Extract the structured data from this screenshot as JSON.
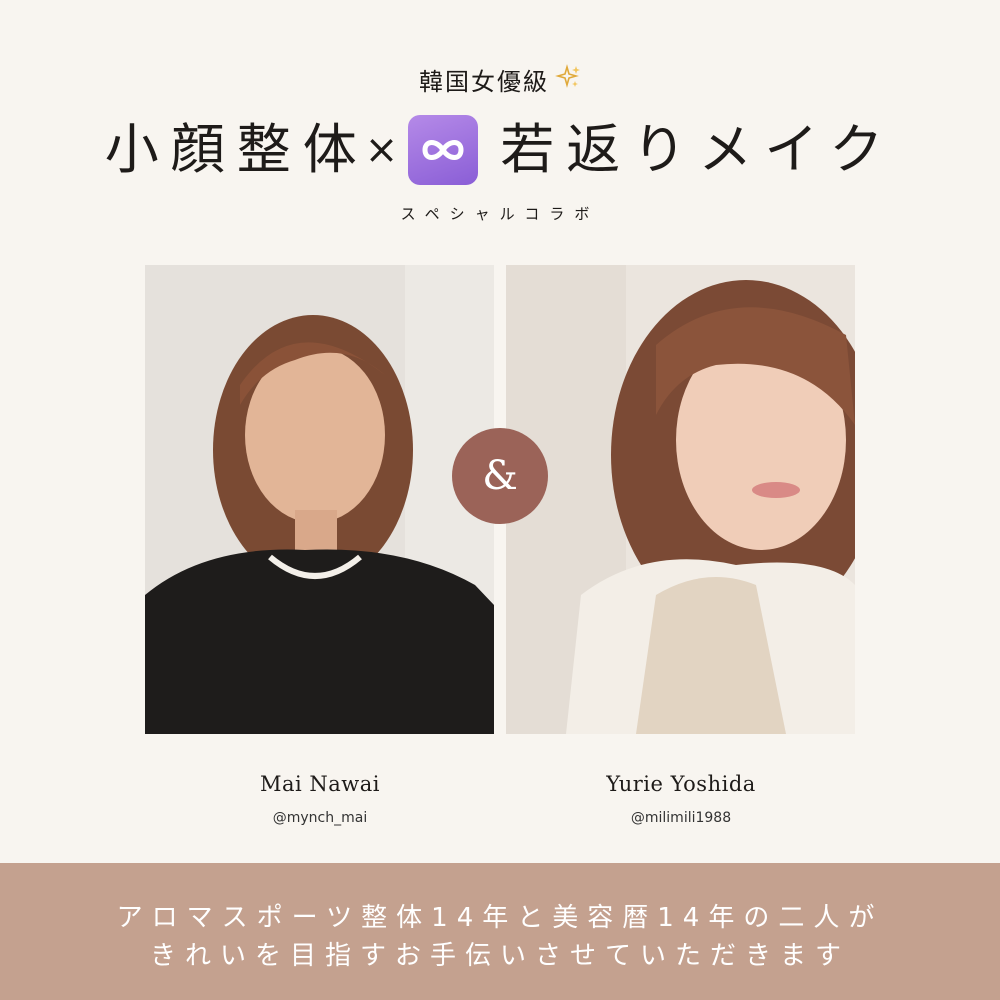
{
  "header": {
    "eyebrow": "韓国女優級",
    "title_left": "小顔整体",
    "title_times": "×",
    "title_right": "若返りメイク",
    "subtitle": "スペシャルコラボ"
  },
  "icons": {
    "eyebrow_icon": "sparkles-icon",
    "title_icon": "infinity-icon"
  },
  "ampersand": "&",
  "people": [
    {
      "name": "Mai Nawai",
      "handle": "@mynch_mai"
    },
    {
      "name": "Yurie Yoshida",
      "handle": "@milimili1988"
    }
  ],
  "footer": {
    "line1": "アロマスポーツ整体14年と美容暦14年の二人が",
    "line2": "きれいを目指すお手伝いさせていただきます"
  },
  "colors": {
    "background": "#f8f5f0",
    "accent": "#9b6358",
    "footer": "#c4a18f",
    "infinity_badge": "#9b6fe0"
  }
}
